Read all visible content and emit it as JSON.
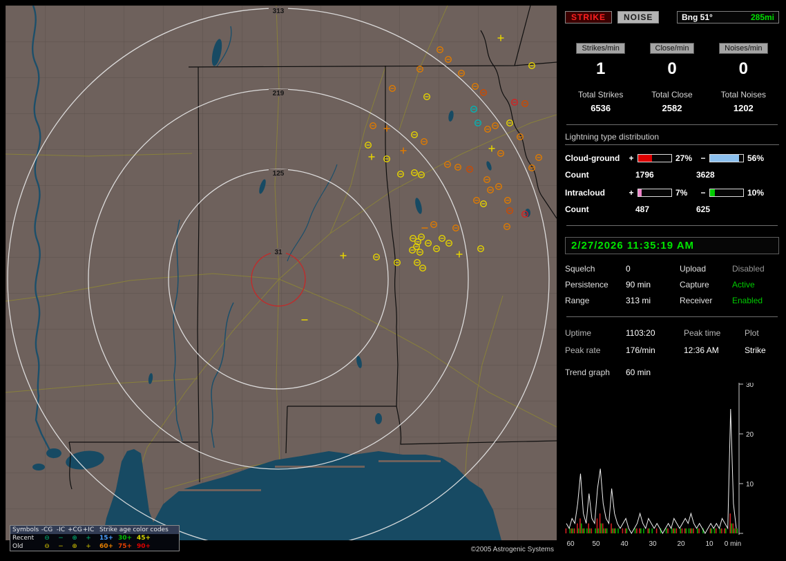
{
  "map": {
    "ring_labels": [
      "313",
      "219",
      "125",
      "31"
    ],
    "copyright": "©2005 Astrogenic Systems",
    "strike_colors": {
      "y": "#e6d400",
      "o": "#e07b00",
      "d": "#cc4a00",
      "r": "#d42020",
      "t": "#00b6b6"
    },
    "strikes": [
      [
        "cm",
        629,
        64,
        "o"
      ],
      [
        "cm",
        641,
        78,
        "o"
      ],
      [
        "cm",
        600,
        92,
        "o"
      ],
      [
        "cm",
        660,
        98,
        "o"
      ],
      [
        "cm",
        680,
        117,
        "o"
      ],
      [
        "cm",
        692,
        126,
        "d"
      ],
      [
        "p",
        717,
        47,
        "y"
      ],
      [
        "cm",
        762,
        87,
        "y"
      ],
      [
        "cm",
        560,
        120,
        "o"
      ],
      [
        "cm",
        610,
        132,
        "y"
      ],
      [
        "cm",
        532,
        174,
        "o"
      ],
      [
        "p",
        552,
        178,
        "o"
      ],
      [
        "cm",
        525,
        202,
        "y"
      ],
      [
        "p",
        530,
        219,
        "y"
      ],
      [
        "cm",
        552,
        222,
        "y"
      ],
      [
        "cm",
        592,
        187,
        "y"
      ],
      [
        "cm",
        606,
        197,
        "o"
      ],
      [
        "cm",
        678,
        150,
        "t"
      ],
      [
        "cm",
        684,
        170,
        "t"
      ],
      [
        "cm",
        698,
        179,
        "o"
      ],
      [
        "cm",
        709,
        174,
        "o"
      ],
      [
        "cm",
        737,
        140,
        "r"
      ],
      [
        "cm",
        752,
        142,
        "d"
      ],
      [
        "cm",
        730,
        170,
        "y"
      ],
      [
        "cm",
        745,
        190,
        "o"
      ],
      [
        "p",
        704,
        207,
        "y"
      ],
      [
        "cm",
        717,
        214,
        "o"
      ],
      [
        "p",
        576,
        210,
        "o"
      ],
      [
        "cm",
        572,
        244,
        "y"
      ],
      [
        "cm",
        592,
        242,
        "y"
      ],
      [
        "cm",
        602,
        245,
        "y"
      ],
      [
        "cm",
        640,
        230,
        "o"
      ],
      [
        "cm",
        655,
        234,
        "o"
      ],
      [
        "cm",
        672,
        237,
        "d"
      ],
      [
        "cm",
        697,
        252,
        "o"
      ],
      [
        "cm",
        702,
        267,
        "o"
      ],
      [
        "cm",
        714,
        262,
        "o"
      ],
      [
        "cm",
        727,
        282,
        "o"
      ],
      [
        "cm",
        682,
        282,
        "o"
      ],
      [
        "cm",
        692,
        287,
        "y"
      ],
      [
        "cm",
        730,
        297,
        "d"
      ],
      [
        "cm",
        752,
        302,
        "r"
      ],
      [
        "cm",
        772,
        220,
        "o"
      ],
      [
        "cm",
        762,
        235,
        "o"
      ],
      [
        "cm",
        620,
        317,
        "o"
      ],
      [
        "m",
        607,
        322,
        "o"
      ],
      [
        "cm",
        652,
        322,
        "o"
      ],
      [
        "cm",
        726,
        320,
        "o"
      ],
      [
        "cm",
        632,
        337,
        "y"
      ],
      [
        "cm",
        642,
        344,
        "y"
      ],
      [
        "cm",
        590,
        337,
        "y"
      ],
      [
        "cm",
        597,
        342,
        "y"
      ],
      [
        "cm",
        602,
        335,
        "y"
      ],
      [
        "cm",
        595,
        349,
        "y"
      ],
      [
        "cm",
        589,
        354,
        "y"
      ],
      [
        "cm",
        600,
        357,
        "y"
      ],
      [
        "cm",
        612,
        344,
        "y"
      ],
      [
        "cm",
        624,
        352,
        "y"
      ],
      [
        "p",
        657,
        360,
        "y"
      ],
      [
        "cm",
        688,
        352,
        "y"
      ],
      [
        "cm",
        567,
        372,
        "y"
      ],
      [
        "cm",
        596,
        372,
        "y"
      ],
      [
        "cm",
        604,
        380,
        "y"
      ],
      [
        "cm",
        537,
        364,
        "y"
      ],
      [
        "p",
        489,
        362,
        "y"
      ],
      [
        "m",
        433,
        455,
        "y"
      ]
    ],
    "legend": {
      "symbols_title": "Symbols",
      "col_headers": [
        "-CG",
        "-IC",
        "+CG",
        "+IC"
      ],
      "age_title": "Strike age color codes",
      "symbol_glyphs": [
        "⊖",
        "−",
        "⊕",
        "+"
      ],
      "symbol_colors": {
        "recent": "#00b878",
        "old": "#d4c400"
      },
      "age_colors": [
        "#4aa0ff",
        "#00c000",
        "#d8d800",
        "#e88000",
        "#e84000",
        "#e00000"
      ],
      "rows": [
        {
          "label": "Recent",
          "ages": [
            "15+",
            "30+",
            "45+"
          ]
        },
        {
          "label": "Old",
          "ages": [
            "60+",
            "75+",
            "90+"
          ]
        }
      ]
    }
  },
  "panel": {
    "strike_btn": "STRIKE",
    "noise_btn": "NOISE",
    "bearing_label": "Bng 51°",
    "bearing_dist": "285mi",
    "rates": [
      {
        "label": "Strikes/min",
        "value": "1"
      },
      {
        "label": "Close/min",
        "value": "0"
      },
      {
        "label": "Noises/min",
        "value": "0"
      }
    ],
    "totals": [
      {
        "label": "Total Strikes",
        "value": "6536"
      },
      {
        "label": "Total Close",
        "value": "2582"
      },
      {
        "label": "Total Noises",
        "value": "1202"
      }
    ],
    "ltd": {
      "header": "Lightning type distribution",
      "count_label": "Count",
      "pos_sign": "+",
      "neg_sign": "−",
      "rows": [
        {
          "label": "Cloud-ground",
          "pos_pct": "27%",
          "neg_pct": "56%",
          "pos_color": "#dd0000",
          "neg_color": "#8cc0ee",
          "counts": [
            "1796",
            "3628"
          ]
        },
        {
          "label": "Intracloud",
          "pos_pct": "7%",
          "neg_pct": "10%",
          "pos_color": "#ee82c8",
          "neg_color": "#00cc00",
          "counts": [
            "487",
            "625"
          ]
        }
      ]
    },
    "datetime": "2/27/2026 11:35:19 AM",
    "settings": {
      "squelch_label": "Squelch",
      "squelch": "0",
      "upload_label": "Upload",
      "upload": "Disabled",
      "persistence_label": "Persistence",
      "persistence": "90 min",
      "capture_label": "Capture",
      "capture": "Active",
      "range_label": "Range",
      "range": "313 mi",
      "receiver_label": "Receiver",
      "receiver": "Enabled"
    },
    "stats": {
      "uptime_label": "Uptime",
      "uptime": "1103:20",
      "peakrate_label": "Peak rate",
      "peakrate": "176/min",
      "peaktime_label": "Peak time",
      "peaktime": "12:36 AM",
      "plot_label": "Plot",
      "plot": "Strike"
    },
    "trend": {
      "label": "Trend graph",
      "window": "60 min",
      "y_ticks": [
        "30",
        "20",
        "10"
      ],
      "x_ticks": [
        "60",
        "50",
        "40",
        "30",
        "20",
        "10",
        "0 min"
      ],
      "values": [
        2,
        1,
        3,
        2,
        6,
        12,
        4,
        2,
        8,
        3,
        2,
        9,
        13,
        6,
        3,
        2,
        9,
        4,
        2,
        1,
        2,
        3,
        1,
        0,
        1,
        2,
        4,
        2,
        1,
        3,
        2,
        1,
        2,
        1,
        0,
        1,
        2,
        1,
        3,
        2,
        1,
        2,
        3,
        2,
        4,
        2,
        1,
        2,
        1,
        0,
        1,
        2,
        1,
        2,
        1,
        3,
        2,
        1,
        25,
        6,
        1
      ],
      "cg": [
        1,
        0,
        1,
        1,
        2,
        3,
        1,
        0,
        2,
        1,
        0,
        3,
        4,
        2,
        1,
        0,
        2,
        1,
        0,
        0,
        1,
        1,
        0,
        0,
        0,
        1,
        1,
        0,
        0,
        1,
        0,
        0,
        1,
        0,
        0,
        0,
        1,
        0,
        1,
        1,
        0,
        1,
        1,
        0,
        1,
        1,
        0,
        1,
        0,
        0,
        0,
        1,
        0,
        1,
        0,
        1,
        1,
        0,
        4,
        2,
        1
      ],
      "ic": [
        0,
        1,
        1,
        0,
        1,
        2,
        1,
        1,
        1,
        0,
        1,
        1,
        2,
        1,
        1,
        0,
        1,
        1,
        1,
        0,
        0,
        1,
        0,
        0,
        1,
        0,
        1,
        1,
        0,
        1,
        1,
        0,
        0,
        1,
        0,
        1,
        0,
        1,
        1,
        0,
        1,
        0,
        1,
        1,
        1,
        0,
        1,
        0,
        1,
        0,
        0,
        1,
        1,
        0,
        1,
        0,
        1,
        0,
        2,
        1,
        1
      ]
    }
  }
}
